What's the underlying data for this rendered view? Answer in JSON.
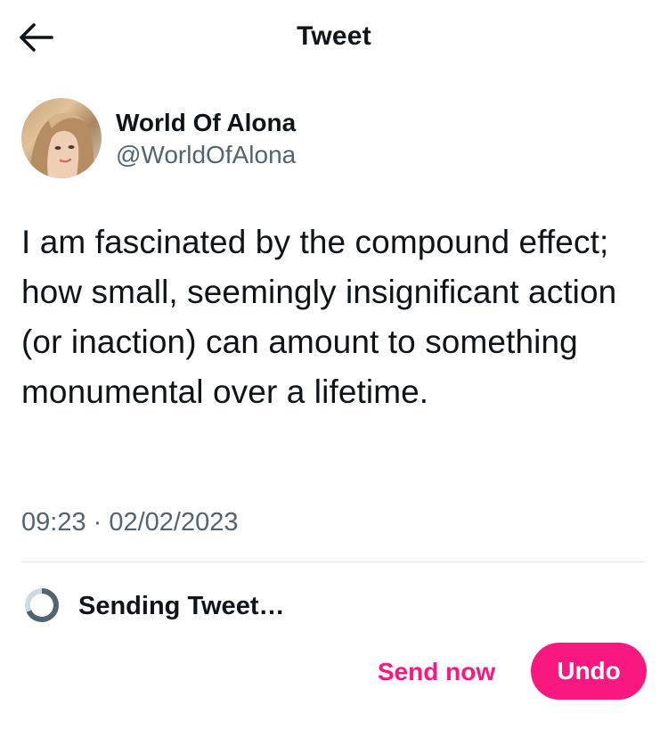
{
  "header": {
    "title": "Tweet",
    "back_icon": "arrow-left-icon"
  },
  "author": {
    "display_name": "World Of Alona",
    "handle": "@WorldOfAlona",
    "avatar": "profile-photo"
  },
  "tweet": {
    "text": "I am fascinated by the compound effect; how small, seemingly insignificant action (or inaction) can amount to something monumental over a lifetime.",
    "timestamp": "09:23 · 02/02/2023"
  },
  "status": {
    "label": "Sending Tweet…",
    "icon": "spinner-icon"
  },
  "actions": {
    "send_now": "Send now",
    "undo": "Undo"
  },
  "colors": {
    "accent": "#f91880",
    "text": "#0f1419",
    "secondary": "#536471",
    "divider": "#e3e7ea"
  }
}
